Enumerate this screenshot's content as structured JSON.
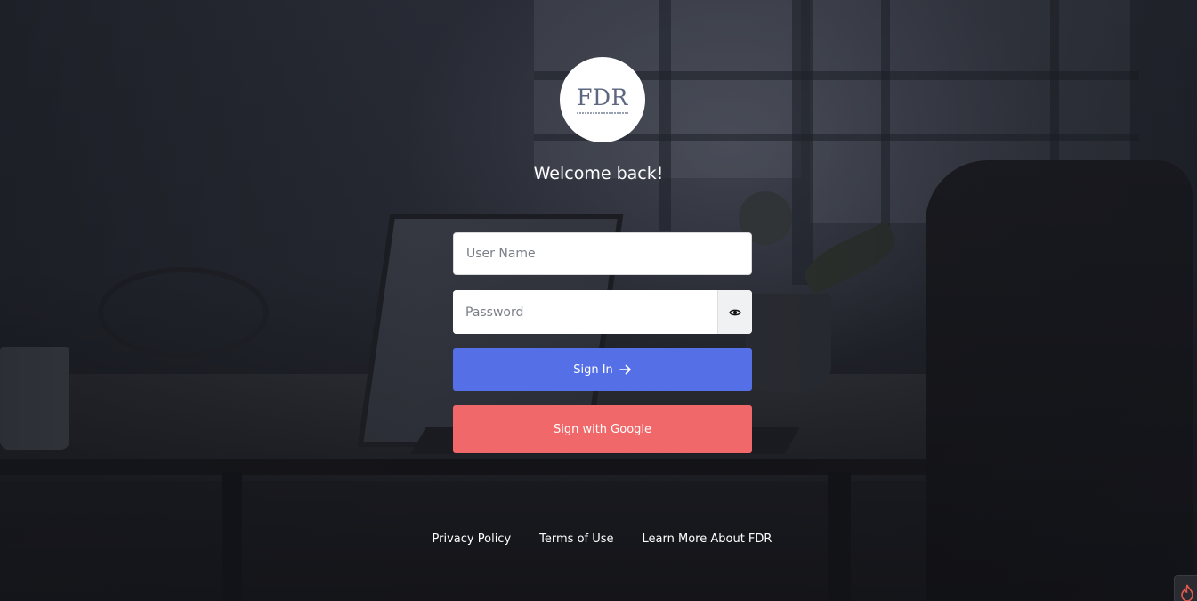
{
  "brand": {
    "logo_text": "FDR",
    "logo_icon": "fdr-logo-icon"
  },
  "welcome": {
    "title": "Welcome back!"
  },
  "form": {
    "username_placeholder": "User Name",
    "password_placeholder": "Password",
    "show_password_icon": "eye-icon",
    "signin_label": "Sign In",
    "signin_icon": "arrow-right-icon",
    "google_label": "Sign with Google"
  },
  "footer": {
    "links": [
      "Privacy Policy",
      "Terms of Use",
      "Learn More About FDR"
    ]
  },
  "colors": {
    "primary_button": "#5570e6",
    "google_button": "#f0686a",
    "logo_text": "#5d6780",
    "background_dark": "#22252e"
  },
  "widgets": {
    "corner_icon": "flame-icon"
  }
}
